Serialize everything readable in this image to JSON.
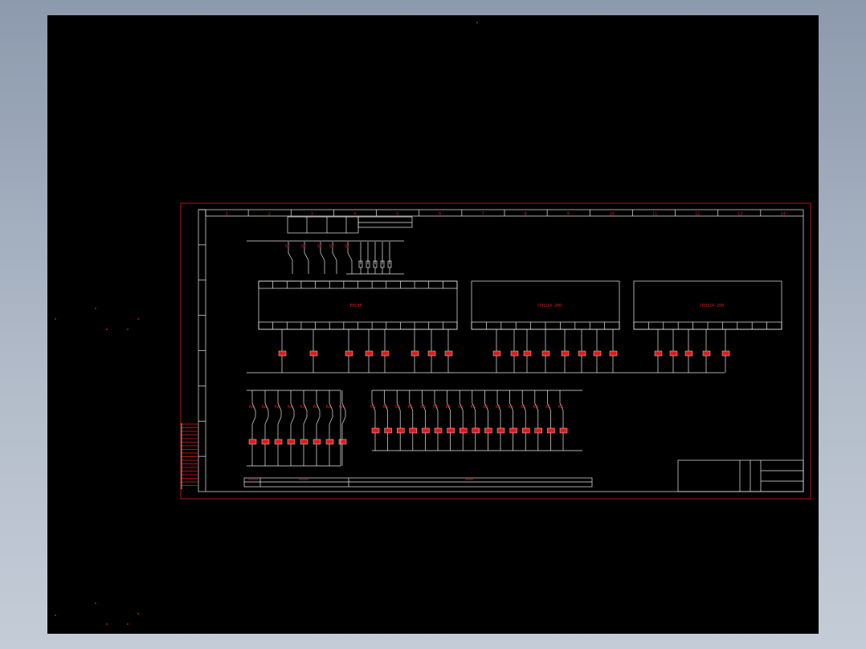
{
  "theme": {
    "background": "#000000",
    "line_red": "#e21a1a",
    "line_white": "#e8e8e8",
    "desktop": "#9aa6b8"
  },
  "drawing": {
    "column_numbers": [
      "1",
      "2",
      "3",
      "4",
      "5",
      "6",
      "7",
      "8",
      "9",
      "10",
      "11",
      "12",
      "13",
      "14"
    ],
    "module_labels": [
      "EM235",
      "CPU214-200",
      "CPU224-200"
    ],
    "header_block": [
      "FU1",
      "FU2",
      "FU3"
    ]
  }
}
